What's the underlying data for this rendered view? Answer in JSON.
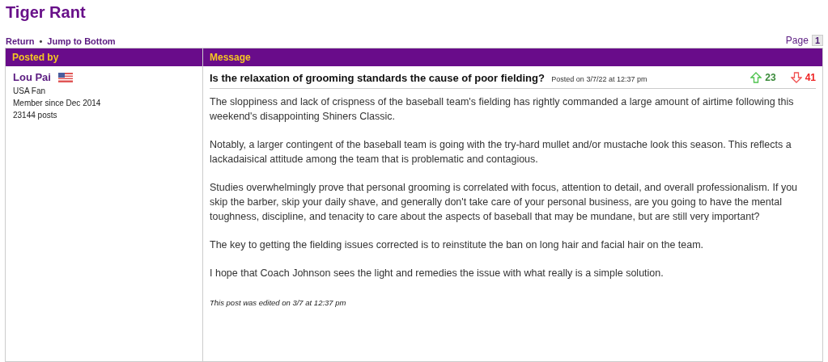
{
  "board_title": "Tiger Rant",
  "nav_links": [
    "Return",
    "Jump to Bottom"
  ],
  "nav_separator": "•",
  "pagination": {
    "label": "Page",
    "pages": [
      {
        "label": "1",
        "selected": true
      }
    ]
  },
  "table": {
    "columns": [
      "Posted by",
      "Message"
    ]
  },
  "author": {
    "name": "Lou Pai",
    "title": "USA Fan",
    "member_since": "Member since Dec 2014",
    "posts": "23144 posts"
  },
  "post": {
    "subject": "Is the relaxation of grooming standards the cause of poor fielding?",
    "posted": "Posted on 3/7/22 at 12:37 pm",
    "upvotes": "23",
    "downvotes": "41",
    "paragraphs": [
      "The sloppiness and lack of crispness of the baseball team's fielding has rightly commanded a large amount of airtime following this weekend's disappointing Shiners Classic.",
      "Notably, a larger contingent of the baseball team is going with the try-hard mullet and/or mustache look this season. This reflects a lackadaisical attitude among the team that is problematic and contagious.",
      "Studies overwhelmingly prove that personal grooming is correlated with focus, attention to detail, and overall professionalism. If you skip the barber, skip your daily shave, and generally don't take care of your personal business, are you going to have the mental toughness, discipline, and tenacity to care about the aspects of baseball that may be mundane, but are still very important?",
      "The key to getting the fielding issues corrected is to reinstitute the ban on long hair and facial hair on the team.",
      "I hope that Coach Johnson sees the light and remedies the issue with what really is a simple solution."
    ],
    "edit_note": "This post was edited on 3/7 at 12:37 pm"
  }
}
